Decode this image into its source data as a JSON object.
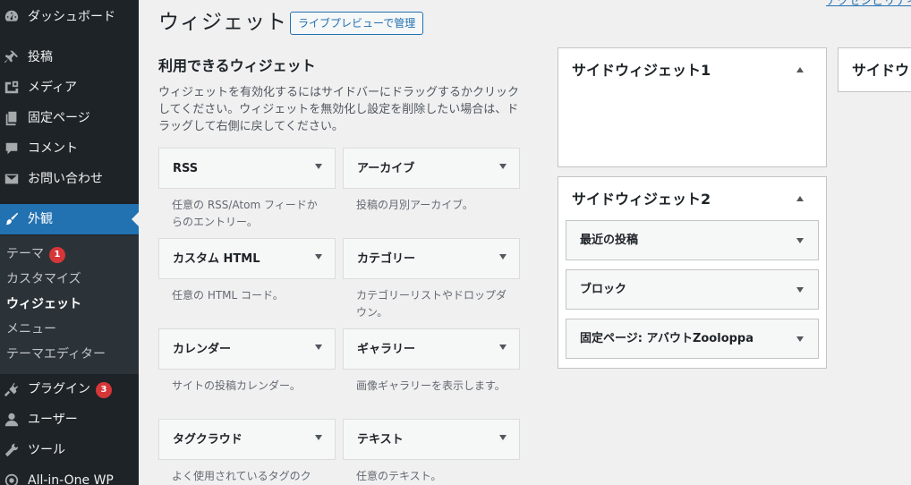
{
  "sidebar": {
    "menu": [
      {
        "label": "ダッシュボード",
        "icon": "dashboard-icon"
      },
      {
        "label": "投稿",
        "icon": "pin-icon"
      },
      {
        "label": "メディア",
        "icon": "media-icon"
      },
      {
        "label": "固定ページ",
        "icon": "page-icon"
      },
      {
        "label": "コメント",
        "icon": "comment-icon"
      },
      {
        "label": "お問い合わせ",
        "icon": "mail-icon"
      },
      {
        "label": "外観",
        "icon": "brush-icon"
      },
      {
        "label": "プラグイン",
        "icon": "plugin-icon",
        "badge": "3"
      },
      {
        "label": "ユーザー",
        "icon": "user-icon"
      },
      {
        "label": "ツール",
        "icon": "wrench-icon"
      },
      {
        "label": "All-in-One WP",
        "icon": "migration-icon"
      }
    ],
    "submenu": [
      {
        "label": "テーマ",
        "badge": "1"
      },
      {
        "label": "カスタマイズ"
      },
      {
        "label": "ウィジェット"
      },
      {
        "label": "メニュー"
      },
      {
        "label": "テーマエディター"
      }
    ]
  },
  "header": {
    "title": "ウィジェット",
    "preview_button": "ライブプレビューで管理",
    "accessibility_link": "アクセシビリティ"
  },
  "available": {
    "title": "利用できるウィジェット",
    "description": "ウィジェットを有効化するにはサイドバーにドラッグするかクリックしてください。ウィジェットを無効化し設定を削除したい場合は、ドラッグして右側に戻してください。",
    "widgets": [
      {
        "name": "RSS",
        "desc": "任意の RSS/Atom フィードからのエントリー。"
      },
      {
        "name": "アーカイブ",
        "desc": "投稿の月別アーカイブ。"
      },
      {
        "name": "カスタム HTML",
        "desc": "任意の HTML コード。"
      },
      {
        "name": "カテゴリー",
        "desc": "カテゴリーリストやドロップダウン。"
      },
      {
        "name": "カレンダー",
        "desc": "サイトの投稿カレンダー。"
      },
      {
        "name": "ギャラリー",
        "desc": "画像ギャラリーを表示します。"
      },
      {
        "name": "タグクラウド",
        "desc": "よく使用されているタグのク"
      },
      {
        "name": "テキスト",
        "desc": "任意のテキスト。"
      }
    ]
  },
  "sidebars": [
    {
      "title": "サイドウィジェット1",
      "widgets": []
    },
    {
      "title": "サイドウィジェット2",
      "widgets": [
        "最近の投稿",
        "ブロック",
        "固定ページ: アバウトZooloppa"
      ]
    },
    {
      "title": "サイドウ"
    }
  ],
  "colors": {
    "accent": "#2271b1",
    "sidebar_bg": "#1d2327",
    "badge": "#d63638",
    "page_bg": "#f0f0f1"
  }
}
